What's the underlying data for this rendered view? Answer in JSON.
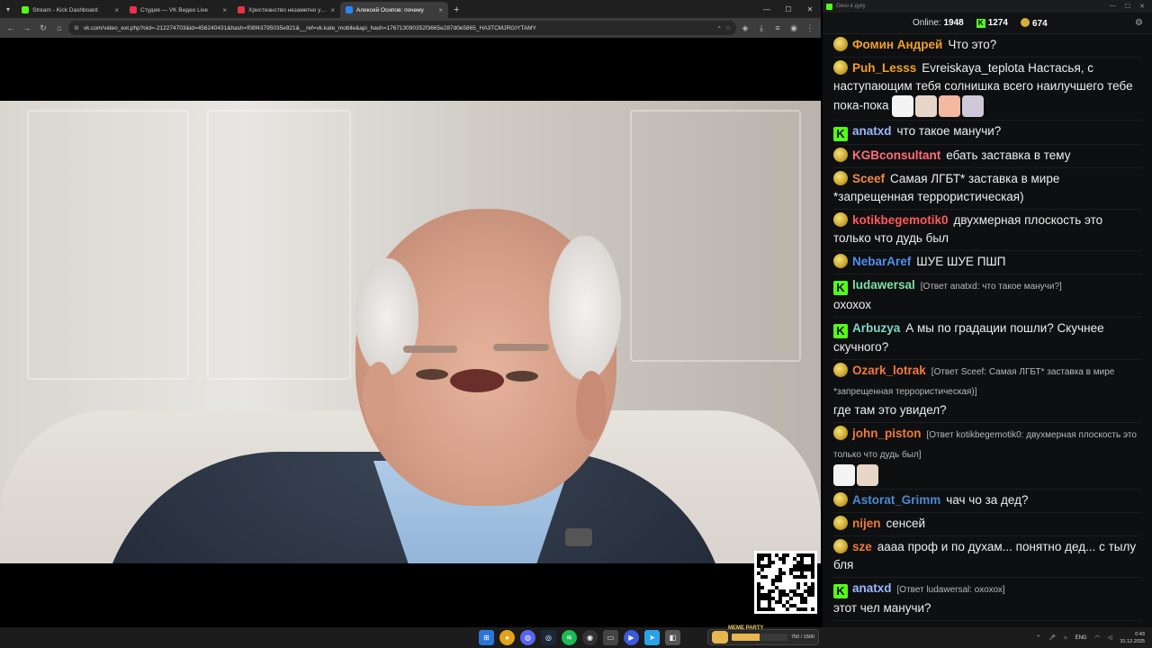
{
  "browser": {
    "tabs": [
      {
        "label": "Stream - Kick Dashboard",
        "color": "#53fc18",
        "active": false
      },
      {
        "label": "Студия — VK Видео Live",
        "color": "#e8334a",
        "active": false
      },
      {
        "label": "Христианство незаметно уход",
        "color": "#e8334a",
        "active": false
      },
      {
        "label": "Алексей Осипов: почему",
        "color": "#2787f5",
        "active": true
      }
    ],
    "url": "vk.com/video_ext.php?oid=-212274703&id=456240431&hash=f08f43795035e921&__ref=vk.kate_mobile&api_hash=176713090352f3665e287d0e5865_HA3TCMJRGIYTAMY",
    "new_tab": "+",
    "close_glyph": "×"
  },
  "chat": {
    "window_title": "Окно в дуку",
    "online_label": "Online:",
    "online_count": "1948",
    "kick_count": "1274",
    "coin_count": "674",
    "messages": [
      {
        "badge": "coin",
        "user": "Фомин Андрей",
        "color": "#f0a02a",
        "reply": "",
        "text": "Что это?",
        "emotes": 0
      },
      {
        "badge": "coin",
        "user": "Puh_Lesss",
        "color": "#f0a02a",
        "reply": "",
        "text": "Evreiskaya_teplota Настасья, с наступающим тебя солнишка всего наилучшего тебе пока-пока",
        "emotes": 4
      },
      {
        "badge": "kick",
        "user": "anatxd",
        "color": "#9ab8ff",
        "reply": "",
        "text": "что такое манучи?",
        "emotes": 0
      },
      {
        "badge": "coin",
        "user": "KGBconsultant",
        "color": "#ff6e7a",
        "reply": "",
        "text": "ебать заставка в тему",
        "emotes": 0
      },
      {
        "badge": "coin",
        "user": "Sceef",
        "color": "#f08a4a",
        "reply": "",
        "text": "Самая ЛГБТ* заставка в мире *запрещенная террористическая)",
        "emotes": 0
      },
      {
        "badge": "coin",
        "user": "kotikbegemotik0",
        "color": "#ff5a5a",
        "reply": "",
        "text": "двухмерная плоскость это только что дудь был",
        "emotes": 0
      },
      {
        "badge": "coin",
        "user": "NebarAref",
        "color": "#4f8ff0",
        "reply": "",
        "text": "ШУЕ ШУЕ ПШП",
        "emotes": 0
      },
      {
        "badge": "kick",
        "user": "ludawersal",
        "color": "#7fe0a2",
        "reply": "[Ответ anatxd: что такое манучи?]",
        "text": "охохох",
        "emotes": 0
      },
      {
        "badge": "kick",
        "user": "Arbuzya",
        "color": "#7fd6c7",
        "reply": "",
        "text": "А мы по градации пошли? Скучнее скучного?",
        "emotes": 0
      },
      {
        "badge": "coin",
        "user": "Ozark_lotrak",
        "color": "#f07a3a",
        "reply": "[Ответ Sceef: Самая ЛГБТ* заставка в мире *запрещенная террористическая)]",
        "text": "где там это увидел?",
        "emotes": 0
      },
      {
        "badge": "coin",
        "user": "john_piston",
        "color": "#f07a3a",
        "reply": "[Ответ kotikbegemotik0: двухмерная плоскость это только что дудь был]",
        "text": "",
        "emotes": 2
      },
      {
        "badge": "coin",
        "user": "Astorat_Grimm",
        "color": "#4a8ad0",
        "reply": "",
        "text": "чач чо за дед?",
        "emotes": 0
      },
      {
        "badge": "coin",
        "user": "nijen",
        "color": "#f07a3a",
        "reply": "",
        "text": "сенсей",
        "emotes": 0
      },
      {
        "badge": "coin",
        "user": "sze",
        "color": "#f07a3a",
        "reply": "",
        "text": "аааа проф и по духам... понятно дед... с тылу бля",
        "emotes": 0
      },
      {
        "badge": "kick",
        "user": "anatxd",
        "color": "#9ab8ff",
        "reply": "[Ответ ludawersal: охохох]",
        "text": "этот чел манучи?",
        "emotes": 0
      }
    ]
  },
  "taskbar": {
    "widget_title": "MEME PARTY",
    "widget_progress": "750 / 1500",
    "widget_fraction": 0.5,
    "lang": "ENG",
    "time": "0:43",
    "date": "31.12.2025"
  }
}
